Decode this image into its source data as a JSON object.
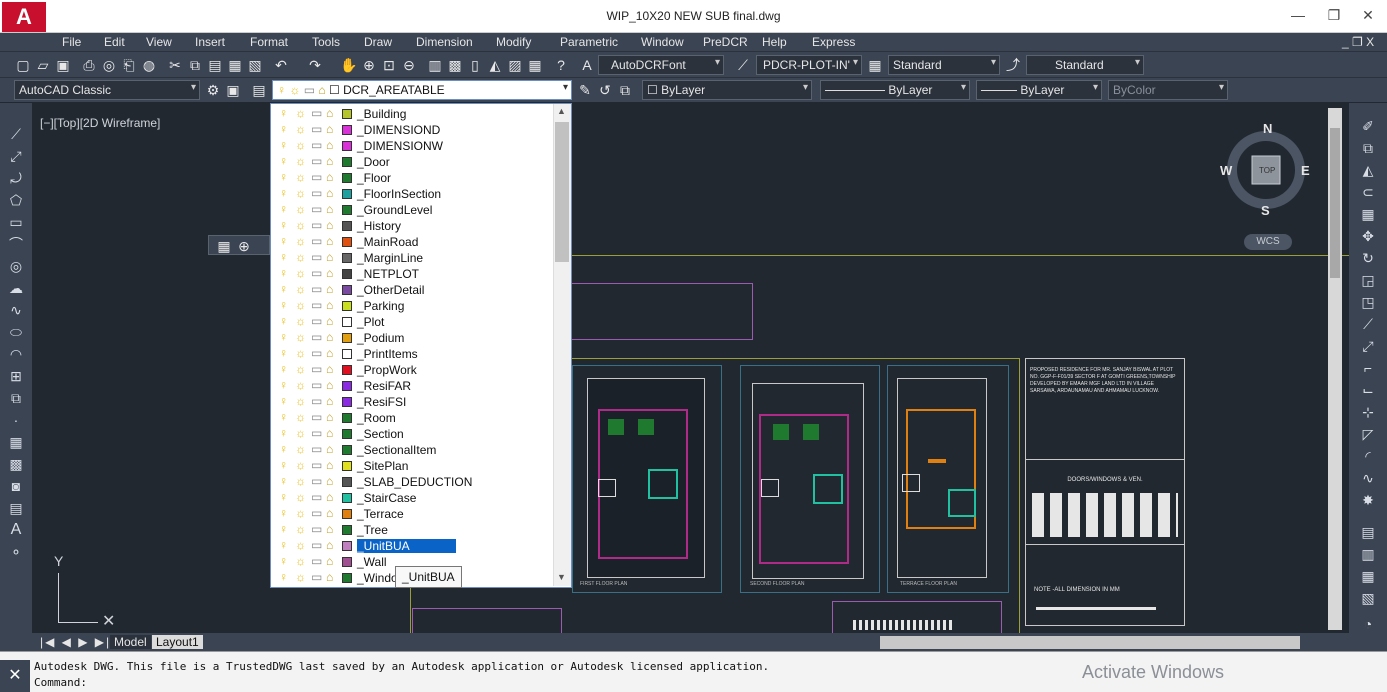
{
  "window": {
    "title": "WIP_10X20 NEW SUB final.dwg",
    "minimize": "—",
    "restore": "❐",
    "close": "✕",
    "doc_controls": "_ ❐ X",
    "logo_letter": "A"
  },
  "menu": [
    "File",
    "Edit",
    "View",
    "Insert",
    "Format",
    "Tools",
    "Draw",
    "Dimension",
    "Modify",
    "Parametric",
    "Window",
    "PreDCR",
    "Help",
    "Express"
  ],
  "toolbar1": {
    "text_style": "AutoDCRFont",
    "dim_style": "PDCR-PLOT-IN'",
    "table_style": "Standard",
    "multileader_style": "Standard"
  },
  "toolbar2": {
    "workspace": "AutoCAD Classic",
    "current_layer": "DCR_AREATABLE",
    "color": "ByLayer",
    "linetype": "ByLayer",
    "lineweight": "ByLayer",
    "plotstyle": "ByColor"
  },
  "viewport_label": "[−][Top][2D Wireframe]",
  "layers": [
    {
      "name": "_Building",
      "color": "#b5c42a"
    },
    {
      "name": "_DIMENSIOND",
      "color": "#d832d8"
    },
    {
      "name": "_DIMENSIONW",
      "color": "#d832d8"
    },
    {
      "name": "_Door",
      "color": "#1f7a2f"
    },
    {
      "name": "_Floor",
      "color": "#1f7a2f"
    },
    {
      "name": "_FloorInSection",
      "color": "#1fa0a0"
    },
    {
      "name": "_GroundLevel",
      "color": "#1f7a2f"
    },
    {
      "name": "_History",
      "color": "#555555"
    },
    {
      "name": "_MainRoad",
      "color": "#e05010"
    },
    {
      "name": "_MarginLine",
      "color": "#666666"
    },
    {
      "name": "_NETPLOT",
      "color": "#444444"
    },
    {
      "name": "_OtherDetail",
      "color": "#7a4aa0"
    },
    {
      "name": "_Parking",
      "color": "#c8e020"
    },
    {
      "name": "_Plot",
      "color": "#ffffff"
    },
    {
      "name": "_Podium",
      "color": "#e0a010"
    },
    {
      "name": "_PrintItems",
      "color": "#ffffff"
    },
    {
      "name": "_PropWork",
      "color": "#e01020"
    },
    {
      "name": "_ResiFAR",
      "color": "#8a2be2"
    },
    {
      "name": "_ResiFSI",
      "color": "#8a2be2"
    },
    {
      "name": "_Room",
      "color": "#1f7a2f"
    },
    {
      "name": "_Section",
      "color": "#1f7a2f"
    },
    {
      "name": "_SectionalItem",
      "color": "#1f7a2f"
    },
    {
      "name": "_SitePlan",
      "color": "#e0e020"
    },
    {
      "name": "_SLAB_DEDUCTION",
      "color": "#555555"
    },
    {
      "name": "_StairCase",
      "color": "#20c0a0"
    },
    {
      "name": "_Terrace",
      "color": "#e08010"
    },
    {
      "name": "_Tree",
      "color": "#1f7a2f"
    },
    {
      "name": "_UnitBUA",
      "color": "#c080c0"
    },
    {
      "name": "_Wall",
      "color": "#a05090"
    },
    {
      "name": "_Windo",
      "color": "#1f7a2f"
    }
  ],
  "selected_layer": "_UnitBUA",
  "tooltip": "_UnitBUA",
  "viewcube": {
    "north": "N",
    "south": "S",
    "east": "E",
    "west": "W",
    "face": "TOP",
    "ucs": "WCS"
  },
  "axis": {
    "y": "Y"
  },
  "tabs": {
    "model": "Model",
    "layout": "Layout1"
  },
  "title_block": {
    "owner_text": "PROPOSED RESIDENCE FOR MR. SANJAY BISWAL AT PLOT NO. GGP-F-F01/39 SECTOR F AT GOMTI GREENS,TOWNSHIP DEVELOPED BY EMAAR MGF LAND LTD IN VILLAGE SARSAWA, ARDAUNAMAU AND AHMAMAU LUCKNOW.",
    "doors_title": "DOORS/WINDOWS & VEN.",
    "note": "NOTE -ALL DIMENSION IN MM"
  },
  "plan_labels": [
    "FIRST FLOOR PLAN",
    "SECOND FLOOR PLAN",
    "TERRACE FLOOR PLAN"
  ],
  "command": {
    "line1": "Autodesk DWG.  This file is a TrustedDWG last saved by an Autodesk application or Autodesk licensed application.",
    "line2": "Command:"
  },
  "watermark": "Activate Windows"
}
